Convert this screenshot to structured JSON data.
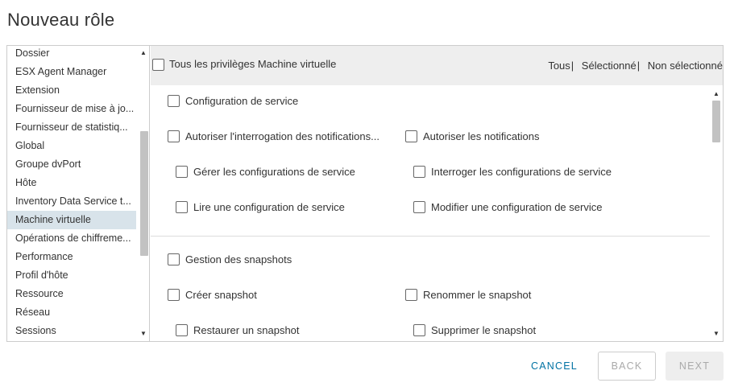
{
  "dialog": {
    "title": "Nouveau rôle"
  },
  "categories": [
    {
      "label": "Dossier"
    },
    {
      "label": "ESX Agent Manager"
    },
    {
      "label": "Extension"
    },
    {
      "label": "Fournisseur de mise à jo..."
    },
    {
      "label": "Fournisseur de statistiq..."
    },
    {
      "label": "Global"
    },
    {
      "label": "Groupe dvPort"
    },
    {
      "label": "Hôte"
    },
    {
      "label": "Inventory Data Service t..."
    },
    {
      "label": "Machine virtuelle",
      "selected": true
    },
    {
      "label": "Opérations de chiffreme..."
    },
    {
      "label": "Performance"
    },
    {
      "label": "Profil d'hôte"
    },
    {
      "label": "Ressource"
    },
    {
      "label": "Réseau"
    },
    {
      "label": "Sessions"
    }
  ],
  "privileges": {
    "all_label": "Tous les privilèges Machine virtuelle",
    "filter": {
      "all": "Tous",
      "selected": "Sélectionné",
      "unselected": "Non sélectionné"
    },
    "groups": {
      "service_config": {
        "label": "Configuration de service",
        "items": [
          "Autoriser l'interrogation des notifications...",
          "Autoriser les notifications",
          "Gérer les configurations de service",
          "Interroger les configurations de service",
          "Lire une configuration de service",
          "Modifier une configuration de service"
        ]
      },
      "snapshots": {
        "label": "Gestion des snapshots",
        "items": [
          "Créer snapshot",
          "Renommer le snapshot",
          "Restaurer un snapshot",
          "Supprimer le snapshot"
        ]
      }
    }
  },
  "footer": {
    "cancel": "CANCEL",
    "back": "BACK",
    "next": "NEXT"
  },
  "icons": {
    "scroll_up": "▲",
    "scroll_down": "▼"
  },
  "colors": {
    "link": "#0072a3",
    "selected_row": "#d8e3ea",
    "header_bg": "#eeeeee"
  }
}
